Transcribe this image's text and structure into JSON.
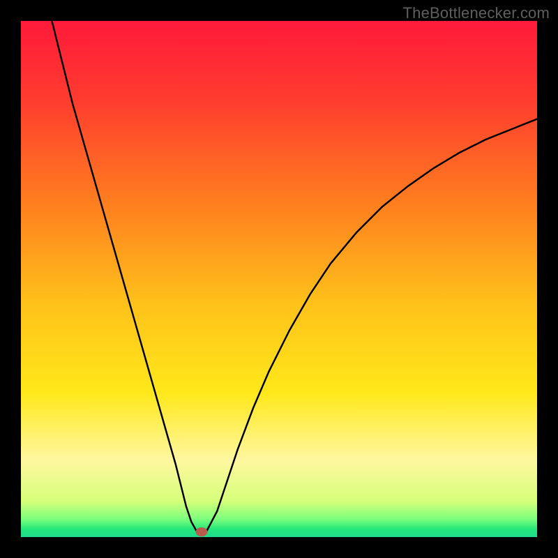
{
  "watermark": "TheBottlenecker.com",
  "colors": {
    "frame": "#000000",
    "gradient_stops": [
      {
        "offset": 0.0,
        "color": "#ff1a3a"
      },
      {
        "offset": 0.15,
        "color": "#ff3b2f"
      },
      {
        "offset": 0.35,
        "color": "#ff7d1f"
      },
      {
        "offset": 0.55,
        "color": "#ffc21a"
      },
      {
        "offset": 0.72,
        "color": "#ffe81a"
      },
      {
        "offset": 0.85,
        "color": "#fff7a0"
      },
      {
        "offset": 0.93,
        "color": "#d6ff7a"
      },
      {
        "offset": 0.965,
        "color": "#7dff7d"
      },
      {
        "offset": 0.985,
        "color": "#23e67a"
      },
      {
        "offset": 1.0,
        "color": "#1fd98f"
      }
    ],
    "curve": "#000000",
    "marker": "#b85a4c"
  },
  "chart_data": {
    "type": "line",
    "title": "",
    "xlabel": "",
    "ylabel": "",
    "xlim": [
      0,
      100
    ],
    "ylim": [
      0,
      100
    ],
    "series": [
      {
        "name": "bottleneck-curve",
        "x": [
          6,
          8,
          10,
          12,
          14,
          16,
          18,
          20,
          22,
          24,
          26,
          28,
          30,
          31,
          32,
          33,
          34,
          35,
          36,
          38,
          40,
          42,
          45,
          48,
          52,
          56,
          60,
          65,
          70,
          75,
          80,
          85,
          90,
          95,
          100
        ],
        "y": [
          100,
          92,
          84,
          77,
          70,
          63,
          56,
          49,
          42,
          35,
          28,
          21,
          14,
          10,
          6,
          3,
          1.2,
          1.0,
          1.2,
          5,
          11,
          17,
          25,
          32,
          40,
          47,
          53,
          59,
          64,
          68,
          71.5,
          74.5,
          77,
          79,
          81
        ]
      }
    ],
    "annotations": [
      {
        "name": "min-marker",
        "x": 35,
        "y": 1.0
      }
    ]
  }
}
